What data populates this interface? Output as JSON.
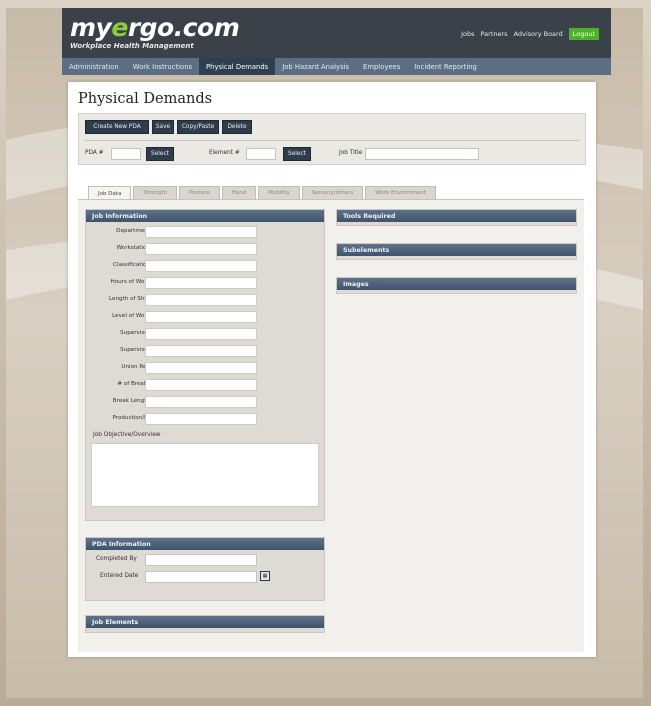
{
  "header": {
    "logo_text_before": "my",
    "logo_text_accent": "e",
    "logo_text_after": "rgo.com",
    "tagline": "Workplace Health Management",
    "links": [
      "Jobs",
      "Partners",
      "Advisory Board"
    ],
    "logout_label": "Logout"
  },
  "nav": {
    "tabs": [
      "Administration",
      "Work Instructions",
      "Physical Demands",
      "Job Hazard Analysis",
      "Employees",
      "Incident Reporting"
    ],
    "active_index": 2
  },
  "page": {
    "title": "Physical Demands"
  },
  "toolbar": {
    "buttons": [
      "Create New PDA",
      "Save",
      "Copy/Paste",
      "Delete"
    ],
    "pda_label": "PDA #",
    "pda_value": "",
    "pda_select": "Select",
    "element_label": "Element #",
    "element_value": "",
    "element_select": "Select",
    "job_title_label": "Job Title",
    "job_title_value": ""
  },
  "tabs": {
    "items": [
      "Job Data",
      "Strength",
      "Posture",
      "Hand",
      "Mobility",
      "Sensory/others",
      "Work Environment"
    ],
    "active_index": 0
  },
  "job_information": {
    "header": "Job Information",
    "fields": [
      {
        "label": "Department",
        "value": ""
      },
      {
        "label": "Workstation",
        "value": ""
      },
      {
        "label": "Classification",
        "value": ""
      },
      {
        "label": "Hours of Work",
        "value": ""
      },
      {
        "label": "Length of Shift",
        "value": ""
      },
      {
        "label": "Level of Work",
        "value": ""
      },
      {
        "label": "Supervisor",
        "value": ""
      },
      {
        "label": "Supervisor",
        "value": ""
      },
      {
        "label": "Union Rep",
        "value": ""
      },
      {
        "label": "# of Breaks",
        "value": ""
      },
      {
        "label": "Break Length",
        "value": ""
      },
      {
        "label": "Production/hr",
        "value": ""
      }
    ],
    "objective_label": "Job Objective/Overview",
    "objective_value": ""
  },
  "pda_information": {
    "header": "PDA Information",
    "completed_by_label": "Completed By",
    "completed_by_value": "",
    "entered_date_label": "Entered Date",
    "entered_date_value": "",
    "calendar_icon": "calendar-icon"
  },
  "job_elements": {
    "header": "Job Elements"
  },
  "right_sections": {
    "tools_required": "Tools Required",
    "subelements": "Subelements",
    "images": "Images"
  }
}
